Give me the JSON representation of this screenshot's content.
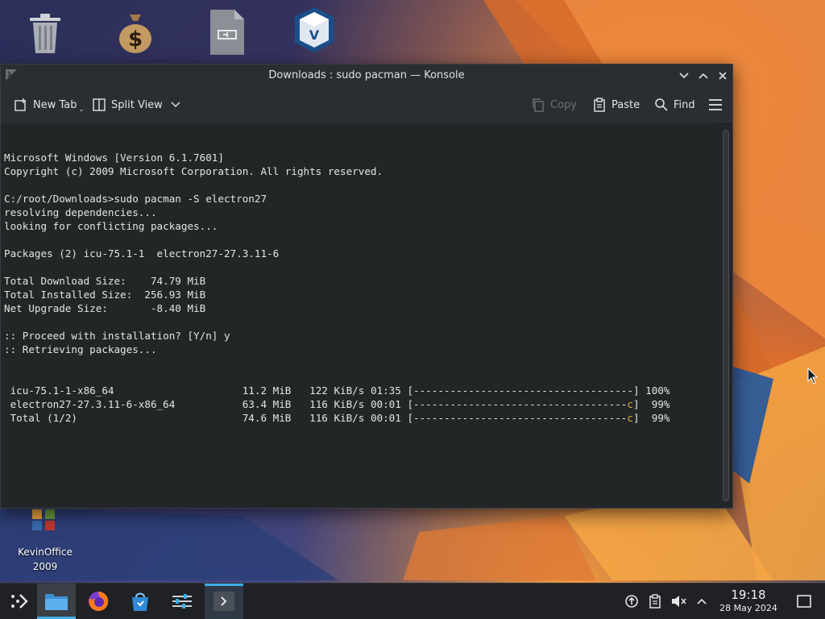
{
  "desktop": {
    "icons": [
      {
        "name": "trash",
        "label": ""
      },
      {
        "name": "money-bag",
        "label": ""
      },
      {
        "name": "script-file",
        "label": ""
      },
      {
        "name": "virtualbox",
        "label": ""
      }
    ],
    "bottom_icon_label_line1": "KevinOffice",
    "bottom_icon_label_line2": "2009"
  },
  "window": {
    "title": "Downloads : sudo pacman — Konsole",
    "toolbar": {
      "new_tab": "New Tab",
      "split_view": "Split View",
      "copy": "Copy",
      "paste": "Paste",
      "find": "Find"
    }
  },
  "terminal": {
    "lines": [
      "Microsoft Windows [Version 6.1.7601]",
      "Copyright (c) 2009 Microsoft Corporation. All rights reserved.",
      "",
      "C:/root/Downloads>sudo pacman -S electron27",
      "resolving dependencies...",
      "looking for conflicting packages...",
      "",
      "Packages (2) icu-75.1-1  electron27-27.3.11-6",
      "",
      "Total Download Size:    74.79 MiB",
      "Total Installed Size:  256.93 MiB",
      "Net Upgrade Size:       -8.40 MiB",
      "",
      ":: Proceed with installation? [Y/n] y",
      ":: Retrieving packages..."
    ],
    "downloads": [
      {
        "name": " icu-75.1-1-x86_64",
        "size": "11.2 MiB",
        "rate": "122 KiB/s",
        "time": "01:35",
        "bar": "[------------------------------------]",
        "bar_tail": "",
        "percent": "100%"
      },
      {
        "name": " electron27-27.3.11-6-x86_64",
        "size": "63.4 MiB",
        "rate": "116 KiB/s",
        "time": "00:01",
        "bar": "[-----------------------------------",
        "bar_tail": "c",
        "bar_end": "]",
        "percent": " 99%"
      },
      {
        "name": " Total (1/2)",
        "size": "74.6 MiB",
        "rate": "116 KiB/s",
        "time": "00:01",
        "bar": "[-----------------------------------",
        "bar_tail": "c",
        "bar_end": "]",
        "percent": " 99%"
      }
    ]
  },
  "taskbar": {
    "time": "19:18",
    "date": "28 May 2024"
  },
  "colors": {
    "accent": "#3daee9",
    "progress_tail": "#e8a23e"
  }
}
